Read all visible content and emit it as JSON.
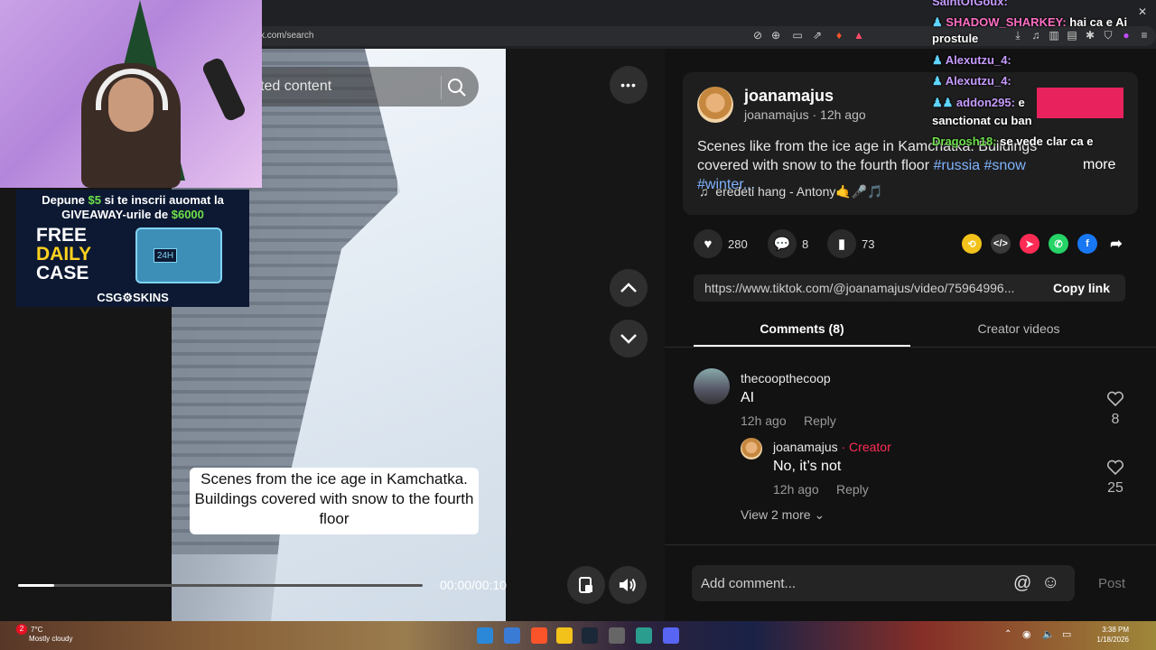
{
  "browser": {
    "url": "k.com/search"
  },
  "player": {
    "search_placeholder": "ted content",
    "caption": "Scenes from the ice age in Kamchatka. Buildings covered with snow to the fourth floor",
    "time": "00:00/00:10",
    "progress_fraction": 0.09,
    "more_label": "•••"
  },
  "post": {
    "username": "joanamajus",
    "subline": "joanamajus · 12h ago",
    "description": "Scenes like from the ice age in Kamchatka. Buildings covered with snow to the fourth floor ",
    "tags": [
      "#russia",
      "#snow",
      "#winter..."
    ],
    "more": "more",
    "music": "eredeti hang - Antony🤙🎤🎵",
    "likes": "280",
    "comments": "8",
    "saves": "73",
    "link": "https://www.tiktok.com/@joanamajus/video/75964996...",
    "copy_link": "Copy link"
  },
  "tabs": {
    "comments": "Comments (8)",
    "creator": "Creator videos"
  },
  "comments": [
    {
      "name": "thecoopthecoop",
      "text": "AI",
      "time": "12h ago",
      "reply": "Reply",
      "likes": "8"
    },
    {
      "name": "joanamajus",
      "badge": "· Creator",
      "text": "No, it’s not",
      "time": "12h ago",
      "reply": "Reply",
      "likes": "25"
    }
  ],
  "view_more": "View 2 more",
  "composer": {
    "placeholder": "Add comment...",
    "post": "Post"
  },
  "ad": {
    "line1_a": "Depune ",
    "line1_b": "$5",
    "line1_c": " si te inscrii auomat la",
    "line2_a": "GIVEAWAY-urile de ",
    "line2_b": "$6000",
    "free": "FREE",
    "daily": "DAILY",
    "case": "CASE",
    "badge": "24H",
    "brand": "CSG⚙SKINS"
  },
  "chat": [
    {
      "user": "SaintOfGoux:",
      "msg": ""
    },
    {
      "user": "SHADOW_SHARKEY:",
      "msg": " hai ca e Ai"
    },
    {
      "user": "",
      "msg": "prostule"
    },
    {
      "user": "Alexutzu_4:",
      "msg": ""
    },
    {
      "user": "Alexutzu_4:",
      "msg": ""
    },
    {
      "user": "addon295:",
      "msg": " e"
    },
    {
      "user": "",
      "msg": "sanctionat cu ban"
    },
    {
      "user": "Dragosh18:",
      "msg": " se vede clar ca e"
    }
  ],
  "taskbar": {
    "temp": "7°C",
    "weather": "Mostly cloudy",
    "time": "3:38 PM",
    "date": "1/18/2026",
    "notif": "2"
  },
  "colors": {
    "accent": "#fe2c55",
    "tag": "#7fb3ff",
    "creator": "#fe2c55"
  }
}
